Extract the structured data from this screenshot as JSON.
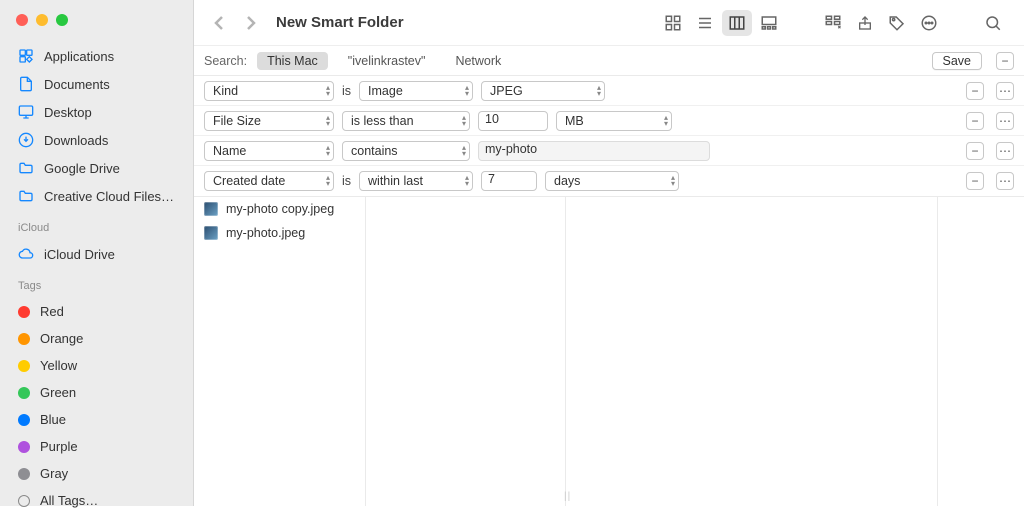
{
  "window": {
    "title": "New Smart Folder"
  },
  "sidebar": {
    "favorites": [
      {
        "label": "Applications",
        "icon": "applications-icon"
      },
      {
        "label": "Documents",
        "icon": "documents-icon"
      },
      {
        "label": "Desktop",
        "icon": "desktop-icon"
      },
      {
        "label": "Downloads",
        "icon": "downloads-icon"
      },
      {
        "label": "Google Drive",
        "icon": "folder-icon"
      },
      {
        "label": "Creative Cloud Files…",
        "icon": "folder-icon"
      }
    ],
    "icloud_header": "iCloud",
    "icloud": [
      {
        "label": "iCloud Drive",
        "icon": "cloud-icon"
      }
    ],
    "tags_header": "Tags",
    "tags": [
      {
        "label": "Red",
        "color": "#ff3b30"
      },
      {
        "label": "Orange",
        "color": "#ff9500"
      },
      {
        "label": "Yellow",
        "color": "#ffcc00"
      },
      {
        "label": "Green",
        "color": "#34c759"
      },
      {
        "label": "Blue",
        "color": "#007aff"
      },
      {
        "label": "Purple",
        "color": "#af52de"
      },
      {
        "label": "Gray",
        "color": "#8e8e93"
      }
    ],
    "all_tags_label": "All Tags…"
  },
  "search": {
    "label": "Search:",
    "scope_this_mac": "This Mac",
    "scope_user": "\"ivelinkrastev\"",
    "scope_network": "Network",
    "save_label": "Save"
  },
  "criteria": [
    {
      "attr": "Kind",
      "joiner": "is",
      "val1": "Image",
      "val2": "JPEG",
      "type": "two-select"
    },
    {
      "attr": "File Size",
      "joiner": "",
      "op": "is less than",
      "num": "10",
      "unit": "MB",
      "type": "size"
    },
    {
      "attr": "Name",
      "joiner": "",
      "op": "contains",
      "text": "my-photo",
      "type": "text"
    },
    {
      "attr": "Created date",
      "joiner": "is",
      "op": "within last",
      "num": "7",
      "unit": "days",
      "type": "date"
    }
  ],
  "results": [
    {
      "name": "my-photo copy.jpeg"
    },
    {
      "name": "my-photo.jpeg"
    }
  ],
  "buttons": {
    "minus": "−",
    "plus": "+",
    "more": "⋯"
  }
}
